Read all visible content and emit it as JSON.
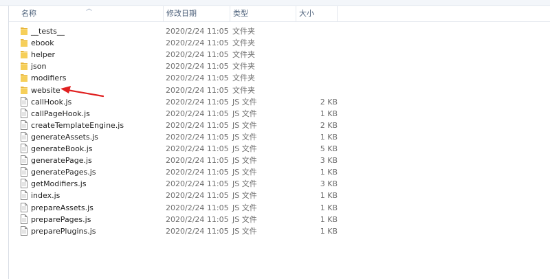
{
  "header": {
    "name_label": "名称",
    "date_label": "修改日期",
    "type_label": "类型",
    "size_label": "大小"
  },
  "files": [
    {
      "name": "__tests__",
      "date": "2020/2/24 11:05",
      "type": "文件夹",
      "size": "",
      "kind": "folder"
    },
    {
      "name": "ebook",
      "date": "2020/2/24 11:05",
      "type": "文件夹",
      "size": "",
      "kind": "folder"
    },
    {
      "name": "helper",
      "date": "2020/2/24 11:05",
      "type": "文件夹",
      "size": "",
      "kind": "folder"
    },
    {
      "name": "json",
      "date": "2020/2/24 11:05",
      "type": "文件夹",
      "size": "",
      "kind": "folder"
    },
    {
      "name": "modifiers",
      "date": "2020/2/24 11:05",
      "type": "文件夹",
      "size": "",
      "kind": "folder"
    },
    {
      "name": "website",
      "date": "2020/2/24 11:05",
      "type": "文件夹",
      "size": "",
      "kind": "folder"
    },
    {
      "name": "callHook.js",
      "date": "2020/2/24 11:05",
      "type": "JS 文件",
      "size": "2 KB",
      "kind": "file"
    },
    {
      "name": "callPageHook.js",
      "date": "2020/2/24 11:05",
      "type": "JS 文件",
      "size": "1 KB",
      "kind": "file"
    },
    {
      "name": "createTemplateEngine.js",
      "date": "2020/2/24 11:05",
      "type": "JS 文件",
      "size": "2 KB",
      "kind": "file"
    },
    {
      "name": "generateAssets.js",
      "date": "2020/2/24 11:05",
      "type": "JS 文件",
      "size": "1 KB",
      "kind": "file"
    },
    {
      "name": "generateBook.js",
      "date": "2020/2/24 11:05",
      "type": "JS 文件",
      "size": "5 KB",
      "kind": "file"
    },
    {
      "name": "generatePage.js",
      "date": "2020/2/24 11:05",
      "type": "JS 文件",
      "size": "3 KB",
      "kind": "file"
    },
    {
      "name": "generatePages.js",
      "date": "2020/2/24 11:05",
      "type": "JS 文件",
      "size": "1 KB",
      "kind": "file"
    },
    {
      "name": "getModifiers.js",
      "date": "2020/2/24 11:05",
      "type": "JS 文件",
      "size": "3 KB",
      "kind": "file"
    },
    {
      "name": "index.js",
      "date": "2020/2/24 11:05",
      "type": "JS 文件",
      "size": "1 KB",
      "kind": "file"
    },
    {
      "name": "prepareAssets.js",
      "date": "2020/2/24 11:05",
      "type": "JS 文件",
      "size": "1 KB",
      "kind": "file"
    },
    {
      "name": "preparePages.js",
      "date": "2020/2/24 11:05",
      "type": "JS 文件",
      "size": "1 KB",
      "kind": "file"
    },
    {
      "name": "preparePlugins.js",
      "date": "2020/2/24 11:05",
      "type": "JS 文件",
      "size": "1 KB",
      "kind": "file"
    }
  ],
  "icons": {
    "folder": "folder-icon",
    "file": "js-file-icon",
    "annotation": "red-arrow-annotation"
  },
  "colors": {
    "header_text": "#4c607a",
    "annotation_red": "#e02020",
    "folder_yellow": "#e8b53a"
  }
}
